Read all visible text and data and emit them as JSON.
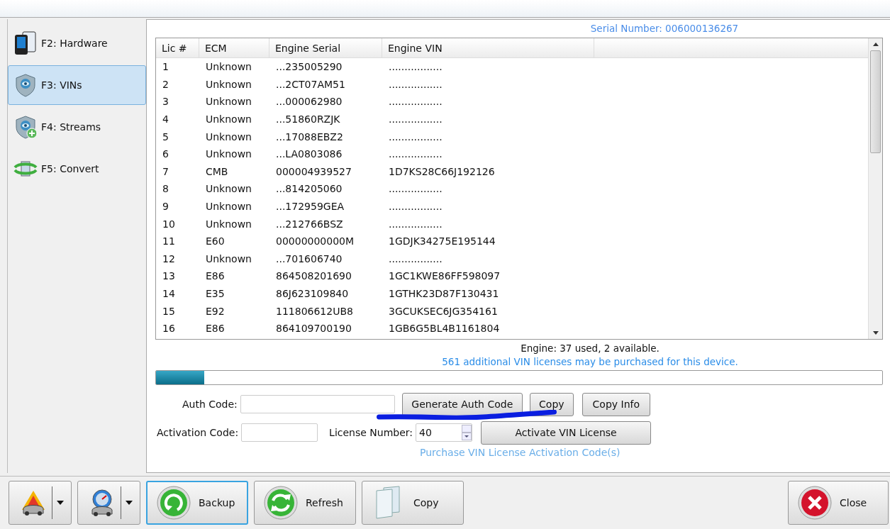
{
  "sidebar": {
    "items": [
      {
        "key": "F2: Hardware",
        "selected": false
      },
      {
        "key": "F3: VINs",
        "selected": true
      },
      {
        "key": "F4: Streams",
        "selected": false
      },
      {
        "key": "F5: Convert",
        "selected": false
      }
    ]
  },
  "serial_number": "Serial Number: 006000136267",
  "table": {
    "columns": [
      "Lic #",
      "ECM",
      "Engine Serial",
      "Engine VIN"
    ],
    "rows": [
      [
        "1",
        "Unknown",
        "...235005290",
        "................."
      ],
      [
        "2",
        "Unknown",
        "...2CT07AM51",
        "................."
      ],
      [
        "3",
        "Unknown",
        "...000062980",
        "................."
      ],
      [
        "4",
        "Unknown",
        "...51860RZJK",
        "................."
      ],
      [
        "5",
        "Unknown",
        "...17088EBZ2",
        "................."
      ],
      [
        "6",
        "Unknown",
        "...LA0803086",
        "................."
      ],
      [
        "7",
        "CMB",
        "000004939527",
        "1D7KS28C66J192126"
      ],
      [
        "8",
        "Unknown",
        "...814205060",
        "................."
      ],
      [
        "9",
        "Unknown",
        "...172959GEA",
        "................."
      ],
      [
        "10",
        "Unknown",
        "...212766BSZ",
        "................."
      ],
      [
        "11",
        "E60",
        "00000000000M",
        "1GDJK34275E195144"
      ],
      [
        "12",
        "Unknown",
        "...701606740",
        "................."
      ],
      [
        "13",
        "E86",
        "864508201690",
        "1GC1KWE86FF598097"
      ],
      [
        "14",
        "E35",
        "86J623109840",
        "1GTHK23D87F130431"
      ],
      [
        "15",
        "E92",
        "111806612UB8",
        "3GCUKSEC6JG354161"
      ],
      [
        "16",
        "E86",
        "864109700190",
        "1GB6G5BL4B1161804"
      ]
    ]
  },
  "engine_status": "Engine: 37 used, 2 available.",
  "purchase_note": "561 additional VIN licenses may be purchased for this device.",
  "progress": {
    "level": 0.066
  },
  "auth_code": {
    "label": "Auth Code:"
  },
  "generate_button": "Generate Auth Code",
  "copy_button": "Copy",
  "copy_info_button": "Copy Info",
  "activation_code": {
    "label": "Activation Code:"
  },
  "license_number": {
    "label": "License Number:",
    "value": "40"
  },
  "activate_button": "Activate VIN License",
  "purchase_link": "Purchase VIN License Activation Code(s)",
  "toolbar": [
    {
      "kind": "split"
    },
    {
      "kind": "split"
    },
    {
      "kind": "button",
      "label": "Backup",
      "selected": true
    },
    {
      "kind": "button",
      "label": "Refresh",
      "selected": false
    },
    {
      "kind": "button",
      "label": "Copy",
      "selected": false
    }
  ],
  "close_button": "Close"
}
